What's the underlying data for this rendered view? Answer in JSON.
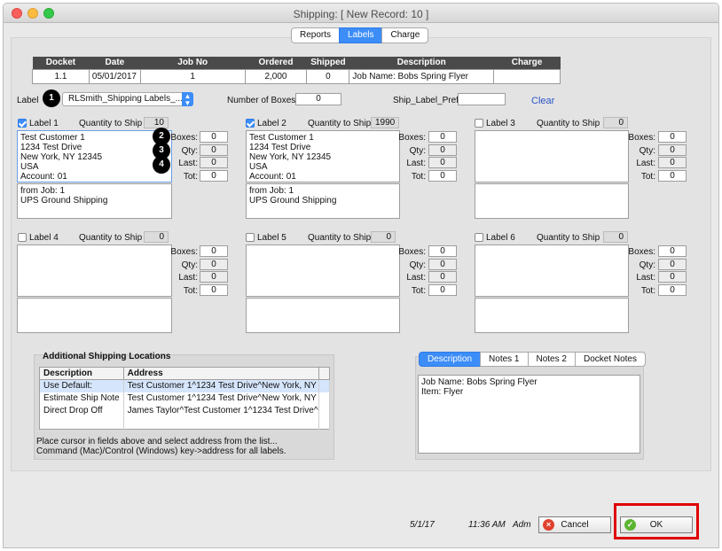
{
  "window": {
    "title": "Shipping:  [ New Record: 10 ]"
  },
  "tabs": [
    {
      "label": "Reports",
      "active": false
    },
    {
      "label": "Labels",
      "active": true
    },
    {
      "label": "Charge",
      "active": false
    }
  ],
  "docket_table": {
    "headers": [
      "Docket",
      "Date",
      "Job No",
      "Ordered",
      "Shipped",
      "Description",
      "Charge"
    ],
    "row": [
      "1.1",
      "05/01/2017",
      "1",
      "2,000",
      "0",
      "Job Name: Bobs Spring Flyer",
      ""
    ]
  },
  "label_row": {
    "label_text": "Label",
    "label_select": "RLSmith_Shipping Labels_...",
    "num_boxes_label": "Number of Boxes",
    "num_boxes_value": "0",
    "pref_label": "Ship_Label_Pref",
    "pref_value": "",
    "clear": "Clear"
  },
  "badges": [
    "1",
    "2",
    "3",
    "4"
  ],
  "label_panels": [
    {
      "title": "Label 1",
      "checked": true,
      "qty_label": "Quantity to Ship",
      "qty": "10",
      "address": [
        "Test Customer 1",
        "1234 Test Drive",
        "New York, NY  12345",
        "USA",
        "Account: 01"
      ],
      "shipping": [
        "from Job: 1",
        "UPS Ground Shipping"
      ],
      "boxes_label": "Boxes:",
      "qty_field_label": "Qty:",
      "last_label": "Last:",
      "tot_label": "Tot:",
      "boxes": "0",
      "qty_field": "0",
      "last": "0",
      "tot": "0"
    },
    {
      "title": "Label 2",
      "checked": true,
      "qty_label": "Quantity to Ship",
      "qty": "1990",
      "address": [
        "Test Customer 1",
        "1234 Test Drive",
        "New York, NY  12345",
        "USA",
        "Account: 01"
      ],
      "shipping": [
        "from Job: 1",
        "UPS Ground Shipping"
      ],
      "boxes_label": "Boxes:",
      "qty_field_label": "Qty:",
      "last_label": "Last:",
      "tot_label": "Tot:",
      "boxes": "0",
      "qty_field": "0",
      "last": "0",
      "tot": "0"
    },
    {
      "title": "Label 3",
      "checked": false,
      "qty_label": "Quantity to Ship",
      "qty": "0",
      "address": [],
      "shipping": [],
      "boxes_label": "Boxes:",
      "qty_field_label": "Qty:",
      "last_label": "Last:",
      "tot_label": "Tot:",
      "boxes": "0",
      "qty_field": "0",
      "last": "0",
      "tot": "0"
    },
    {
      "title": "Label 4",
      "checked": false,
      "qty_label": "Quantity to Ship",
      "qty": "0",
      "address": [],
      "shipping": [],
      "boxes_label": "Boxes:",
      "qty_field_label": "Qty:",
      "last_label": "Last:",
      "tot_label": "Tot:",
      "boxes": "0",
      "qty_field": "0",
      "last": "0",
      "tot": "0"
    },
    {
      "title": "Label 5",
      "checked": false,
      "qty_label": "Quantity to Ship",
      "qty": "0",
      "address": [],
      "shipping": [],
      "boxes_label": "Boxes:",
      "qty_field_label": "Qty:",
      "last_label": "Last:",
      "tot_label": "Tot:",
      "boxes": "0",
      "qty_field": "0",
      "last": "0",
      "tot": "0"
    },
    {
      "title": "Label 6",
      "checked": false,
      "qty_label": "Quantity to Ship",
      "qty": "0",
      "address": [],
      "shipping": [],
      "boxes_label": "Boxes:",
      "qty_field_label": "Qty:",
      "last_label": "Last:",
      "tot_label": "Tot:",
      "boxes": "0",
      "qty_field": "0",
      "last": "0",
      "tot": "0"
    }
  ],
  "additional_shipping": {
    "title": "Additional Shipping Locations",
    "headers": [
      "Description",
      "Address"
    ],
    "rows": [
      {
        "description": "Use Default:",
        "address": "Test Customer 1^1234 Test Drive^New York, NY"
      },
      {
        "description": "Estimate Ship Note",
        "address": "Test Customer 1^1234 Test Drive^New York, NY"
      },
      {
        "description": "Direct Drop Off",
        "address": "James Taylor^Test Customer 1^1234 Test Drive^"
      }
    ],
    "help_line1": "Place cursor in fields above and select address from the list...",
    "help_line2": "Command (Mac)/Control (Windows) key->address for all labels."
  },
  "desc_panel": {
    "tabs": [
      "Description",
      "Notes 1",
      "Notes 2",
      "Docket Notes"
    ],
    "active_tab": "Description",
    "lines": [
      "Job Name: Bobs Spring Flyer",
      "Item: Flyer"
    ]
  },
  "footer": {
    "date": "5/1/17",
    "time": "11:36 AM",
    "user": "Adm",
    "cancel": "Cancel",
    "ok": "OK"
  },
  "colors": {
    "accent": "#3c8df8",
    "highlight": "#e00000"
  }
}
